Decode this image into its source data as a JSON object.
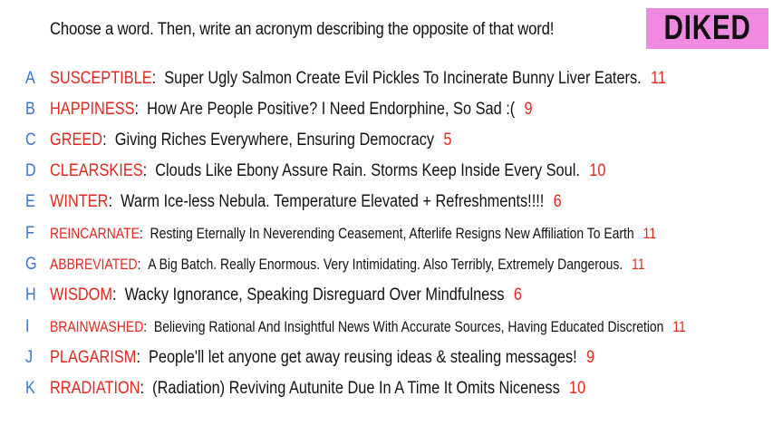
{
  "header": {
    "prompt": "Choose a word. Then, write an acronym describing the opposite of that word!",
    "badge": "DIKED"
  },
  "entries": [
    {
      "letter": "A",
      "word": "SUSCEPTIBLE",
      "acronym": "Super Ugly Salmon Create Evil Pickles To Incinerate Bunny Liver Eaters.",
      "count": "11"
    },
    {
      "letter": "B",
      "word": "HAPPINESS",
      "acronym": "How Are People Positive? I Need Endorphine, So Sad :(",
      "count": "9"
    },
    {
      "letter": "C",
      "word": "GREED",
      "acronym": "Giving Riches Everywhere, Ensuring Democracy",
      "count": "5"
    },
    {
      "letter": "D",
      "word": "CLEARSKIES",
      "acronym": "Clouds Like Ebony Assure Rain. Storms Keep Inside Every Soul.",
      "count": "10"
    },
    {
      "letter": "E",
      "word": "WINTER",
      "acronym": "Warm Ice-less Nebula. Temperature Elevated + Refreshments!!!!",
      "count": "6"
    },
    {
      "letter": "F",
      "word": "REINCARNATE",
      "acronym": "Resting Eternally In Neverending Ceasement, Afterlife Resigns New Affiliation To Earth",
      "count": "11"
    },
    {
      "letter": "G",
      "word": "ABBREVIATED",
      "acronym": "A Big Batch. Really Enormous. Very Intimidating. Also Terribly, Extremely Dangerous.",
      "count": "11"
    },
    {
      "letter": "H",
      "word": "WISDOM",
      "acronym": "Wacky Ignorance, Speaking Disreguard Over Mindfulness",
      "count": "6"
    },
    {
      "letter": "I",
      "word": "BRAINWASHED",
      "acronym": "Believing Rational And Insightful News With Accurate Sources, Having Educated Discretion",
      "count": "11"
    },
    {
      "letter": "J",
      "word": "PLAGARISM",
      "acronym": "People'll let anyone get away reusing ideas & stealing messages!",
      "count": "9"
    },
    {
      "letter": "K",
      "word": "RRADIATION",
      "acronym": "(Radiation) Reviving Autunite Due In A Time It Omits Niceness",
      "count": "10"
    }
  ]
}
